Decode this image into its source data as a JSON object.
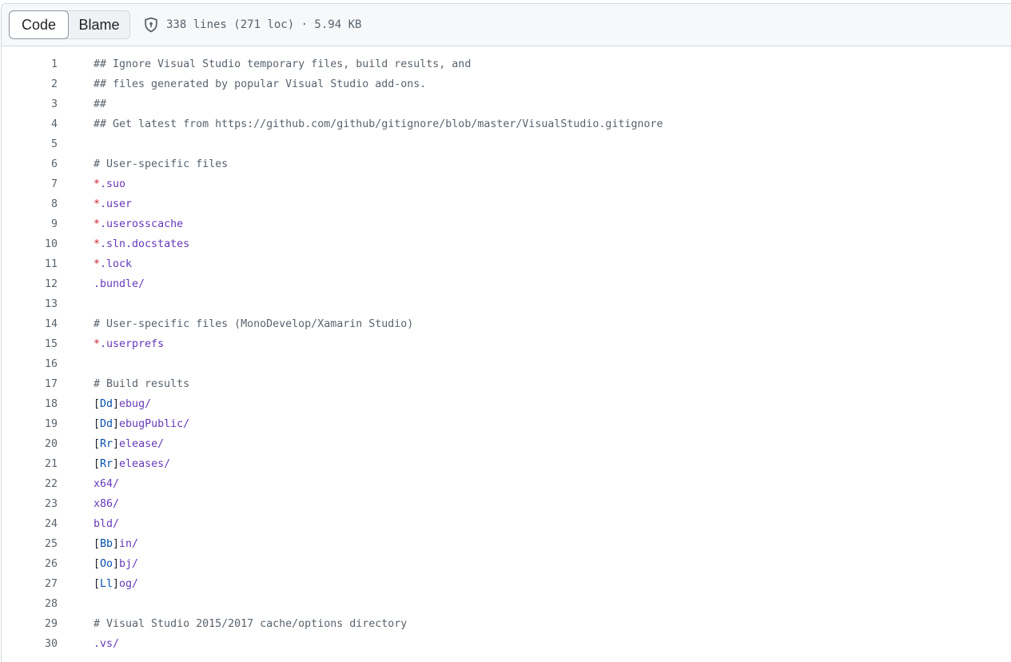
{
  "toolbar": {
    "code_label": "Code",
    "blame_label": "Blame",
    "file_info": "338 lines (271 loc) · 5.94 KB"
  },
  "icons": {
    "security": "shield-icon"
  },
  "lines": [
    {
      "n": "1",
      "parts": [
        {
          "t": "## Ignore Visual Studio temporary files, build results, and",
          "c": "cm"
        }
      ]
    },
    {
      "n": "2",
      "parts": [
        {
          "t": "## files generated by popular Visual Studio add-ons.",
          "c": "cm"
        }
      ]
    },
    {
      "n": "3",
      "parts": [
        {
          "t": "##",
          "c": "cm"
        }
      ]
    },
    {
      "n": "4",
      "parts": [
        {
          "t": "## Get latest from https://github.com/github/gitignore/blob/master/VisualStudio.gitignore",
          "c": "cm"
        }
      ]
    },
    {
      "n": "5",
      "parts": []
    },
    {
      "n": "6",
      "parts": [
        {
          "t": "# User-specific files",
          "c": "cm"
        }
      ]
    },
    {
      "n": "7",
      "parts": [
        {
          "t": "*",
          "c": "star"
        },
        {
          "t": ".suo",
          "c": "path"
        }
      ]
    },
    {
      "n": "8",
      "parts": [
        {
          "t": "*",
          "c": "star"
        },
        {
          "t": ".user",
          "c": "path"
        }
      ]
    },
    {
      "n": "9",
      "parts": [
        {
          "t": "*",
          "c": "star"
        },
        {
          "t": ".userosscache",
          "c": "path"
        }
      ]
    },
    {
      "n": "10",
      "parts": [
        {
          "t": "*",
          "c": "star"
        },
        {
          "t": ".sln.docstates",
          "c": "path"
        }
      ]
    },
    {
      "n": "11",
      "parts": [
        {
          "t": "*",
          "c": "star"
        },
        {
          "t": ".lock",
          "c": "path"
        }
      ]
    },
    {
      "n": "12",
      "parts": [
        {
          "t": ".bundle/",
          "c": "path"
        }
      ]
    },
    {
      "n": "13",
      "parts": []
    },
    {
      "n": "14",
      "parts": [
        {
          "t": "# User-specific files (MonoDevelop/Xamarin Studio)",
          "c": "cm"
        }
      ]
    },
    {
      "n": "15",
      "parts": [
        {
          "t": "*",
          "c": "star"
        },
        {
          "t": ".userprefs",
          "c": "path"
        }
      ]
    },
    {
      "n": "16",
      "parts": []
    },
    {
      "n": "17",
      "parts": [
        {
          "t": "# Build results",
          "c": "cm"
        }
      ]
    },
    {
      "n": "18",
      "parts": [
        {
          "t": "[",
          "c": "txt"
        },
        {
          "t": "Dd",
          "c": "cls"
        },
        {
          "t": "]",
          "c": "txt"
        },
        {
          "t": "ebug/",
          "c": "path"
        }
      ]
    },
    {
      "n": "19",
      "parts": [
        {
          "t": "[",
          "c": "txt"
        },
        {
          "t": "Dd",
          "c": "cls"
        },
        {
          "t": "]",
          "c": "txt"
        },
        {
          "t": "ebugPublic/",
          "c": "path"
        }
      ]
    },
    {
      "n": "20",
      "parts": [
        {
          "t": "[",
          "c": "txt"
        },
        {
          "t": "Rr",
          "c": "cls"
        },
        {
          "t": "]",
          "c": "txt"
        },
        {
          "t": "elease/",
          "c": "path"
        }
      ]
    },
    {
      "n": "21",
      "parts": [
        {
          "t": "[",
          "c": "txt"
        },
        {
          "t": "Rr",
          "c": "cls"
        },
        {
          "t": "]",
          "c": "txt"
        },
        {
          "t": "eleases/",
          "c": "path"
        }
      ]
    },
    {
      "n": "22",
      "parts": [
        {
          "t": "x64/",
          "c": "path"
        }
      ]
    },
    {
      "n": "23",
      "parts": [
        {
          "t": "x86/",
          "c": "path"
        }
      ]
    },
    {
      "n": "24",
      "parts": [
        {
          "t": "bld/",
          "c": "path"
        }
      ]
    },
    {
      "n": "25",
      "parts": [
        {
          "t": "[",
          "c": "txt"
        },
        {
          "t": "Bb",
          "c": "cls"
        },
        {
          "t": "]",
          "c": "txt"
        },
        {
          "t": "in/",
          "c": "path"
        }
      ]
    },
    {
      "n": "26",
      "parts": [
        {
          "t": "[",
          "c": "txt"
        },
        {
          "t": "Oo",
          "c": "cls"
        },
        {
          "t": "]",
          "c": "txt"
        },
        {
          "t": "bj/",
          "c": "path"
        }
      ]
    },
    {
      "n": "27",
      "parts": [
        {
          "t": "[",
          "c": "txt"
        },
        {
          "t": "Ll",
          "c": "cls"
        },
        {
          "t": "]",
          "c": "txt"
        },
        {
          "t": "og/",
          "c": "path"
        }
      ]
    },
    {
      "n": "28",
      "parts": []
    },
    {
      "n": "29",
      "parts": [
        {
          "t": "# Visual Studio 2015/2017 cache/options directory",
          "c": "cm"
        }
      ]
    },
    {
      "n": "30",
      "parts": [
        {
          "t": ".vs/",
          "c": "path"
        }
      ]
    }
  ]
}
